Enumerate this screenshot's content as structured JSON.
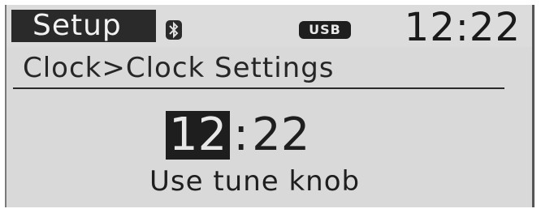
{
  "status_bar": {
    "mode_label": "Setup",
    "bluetooth_icon": "bluetooth-icon",
    "usb_label": "USB",
    "clock": "12:22"
  },
  "breadcrumb": "Clock>Clock Settings",
  "time_setting": {
    "hour": "12",
    "separator": ":",
    "minute": "22"
  },
  "hint": "Use tune knob"
}
